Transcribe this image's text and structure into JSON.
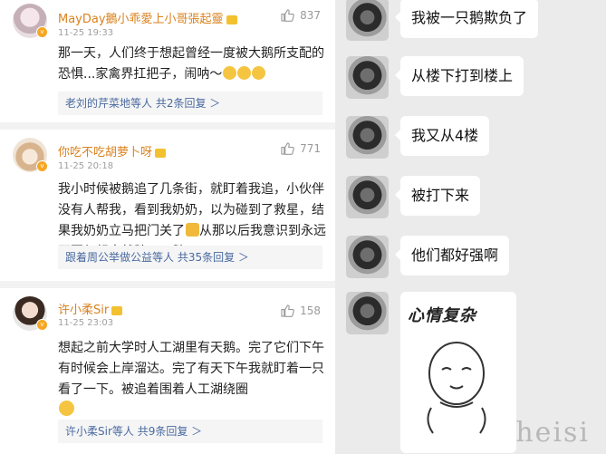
{
  "comments": [
    {
      "username": "MayDay鵝小乖愛上小哥張起靈",
      "time": "11-25 19:33",
      "likes": "837",
      "text": "那一天，人们终于想起曾经一度被大鹅所支配的恐惧...家禽界扛把子，闹呐～",
      "replies": "老刘的芹菜地等人 共2条回复 ＞"
    },
    {
      "username": "你吃不吃胡萝卜呀",
      "time": "11-25 20:18",
      "likes": "771",
      "text": "我小时候被鹅追了几条街，就盯着我追，小伙伴没有人帮我，看到我奶奶，以为碰到了救星，结果我奶奶立马把门关了",
      "text_tail": "从那以后我意识到永远不要幻想去战胜一只鹅",
      "replies": "跟着周公举做公益等人 共35条回复 ＞"
    },
    {
      "username": "许小柔Sir",
      "time": "11-25 23:03",
      "likes": "158",
      "text": "想起之前大学时人工湖里有天鹅。完了它们下午有时候会上岸溜达。完了有天下午我就盯着一只看了一下。被追着围着人工湖绕圈",
      "replies": "许小柔Sir等人 共9条回复 ＞"
    }
  ],
  "chat": {
    "messages": [
      "我被一只鹅欺负了",
      "从楼下打到楼上",
      "我又从4楼",
      "被打下来",
      "他们都好强啊"
    ],
    "sticker_text": "心情复杂"
  },
  "watermark": "heisi",
  "colors": {
    "username": "#d9821e",
    "reply_link": "#4a6aa0",
    "chat_bg": "#ebebeb"
  }
}
